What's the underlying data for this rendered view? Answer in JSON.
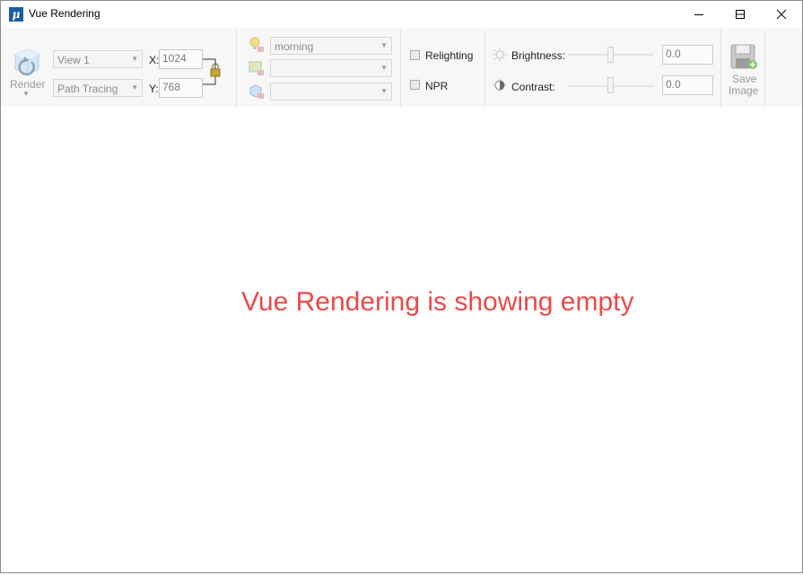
{
  "window": {
    "title": "Vue Rendering",
    "logo_letter": "μ",
    "controls": {
      "minimize": "minimize-icon",
      "maximize": "maximize-icon",
      "close": "close-icon"
    }
  },
  "ribbon": {
    "render_label": "Render",
    "view_select": "View 1",
    "mode_select": "Path Tracing",
    "x_label": "X:",
    "x_value": "1024",
    "y_label": "Y:",
    "y_value": "768",
    "lighting_select": "morning",
    "environment_select": "",
    "material_select": "",
    "relighting_label": "Relighting",
    "npr_label": "NPR",
    "brightness_label": "Brightness:",
    "brightness_value": "0.0",
    "contrast_label": "Contrast:",
    "contrast_value": "0.0",
    "save_label_line1": "Save",
    "save_label_line2": "Image"
  },
  "annotation": {
    "text": "Vue Rendering is showing empty",
    "color": "#ea4a4a"
  },
  "colors": {
    "accent": "#1e5ba8",
    "ribbon_bg": "#f7f7f7"
  }
}
